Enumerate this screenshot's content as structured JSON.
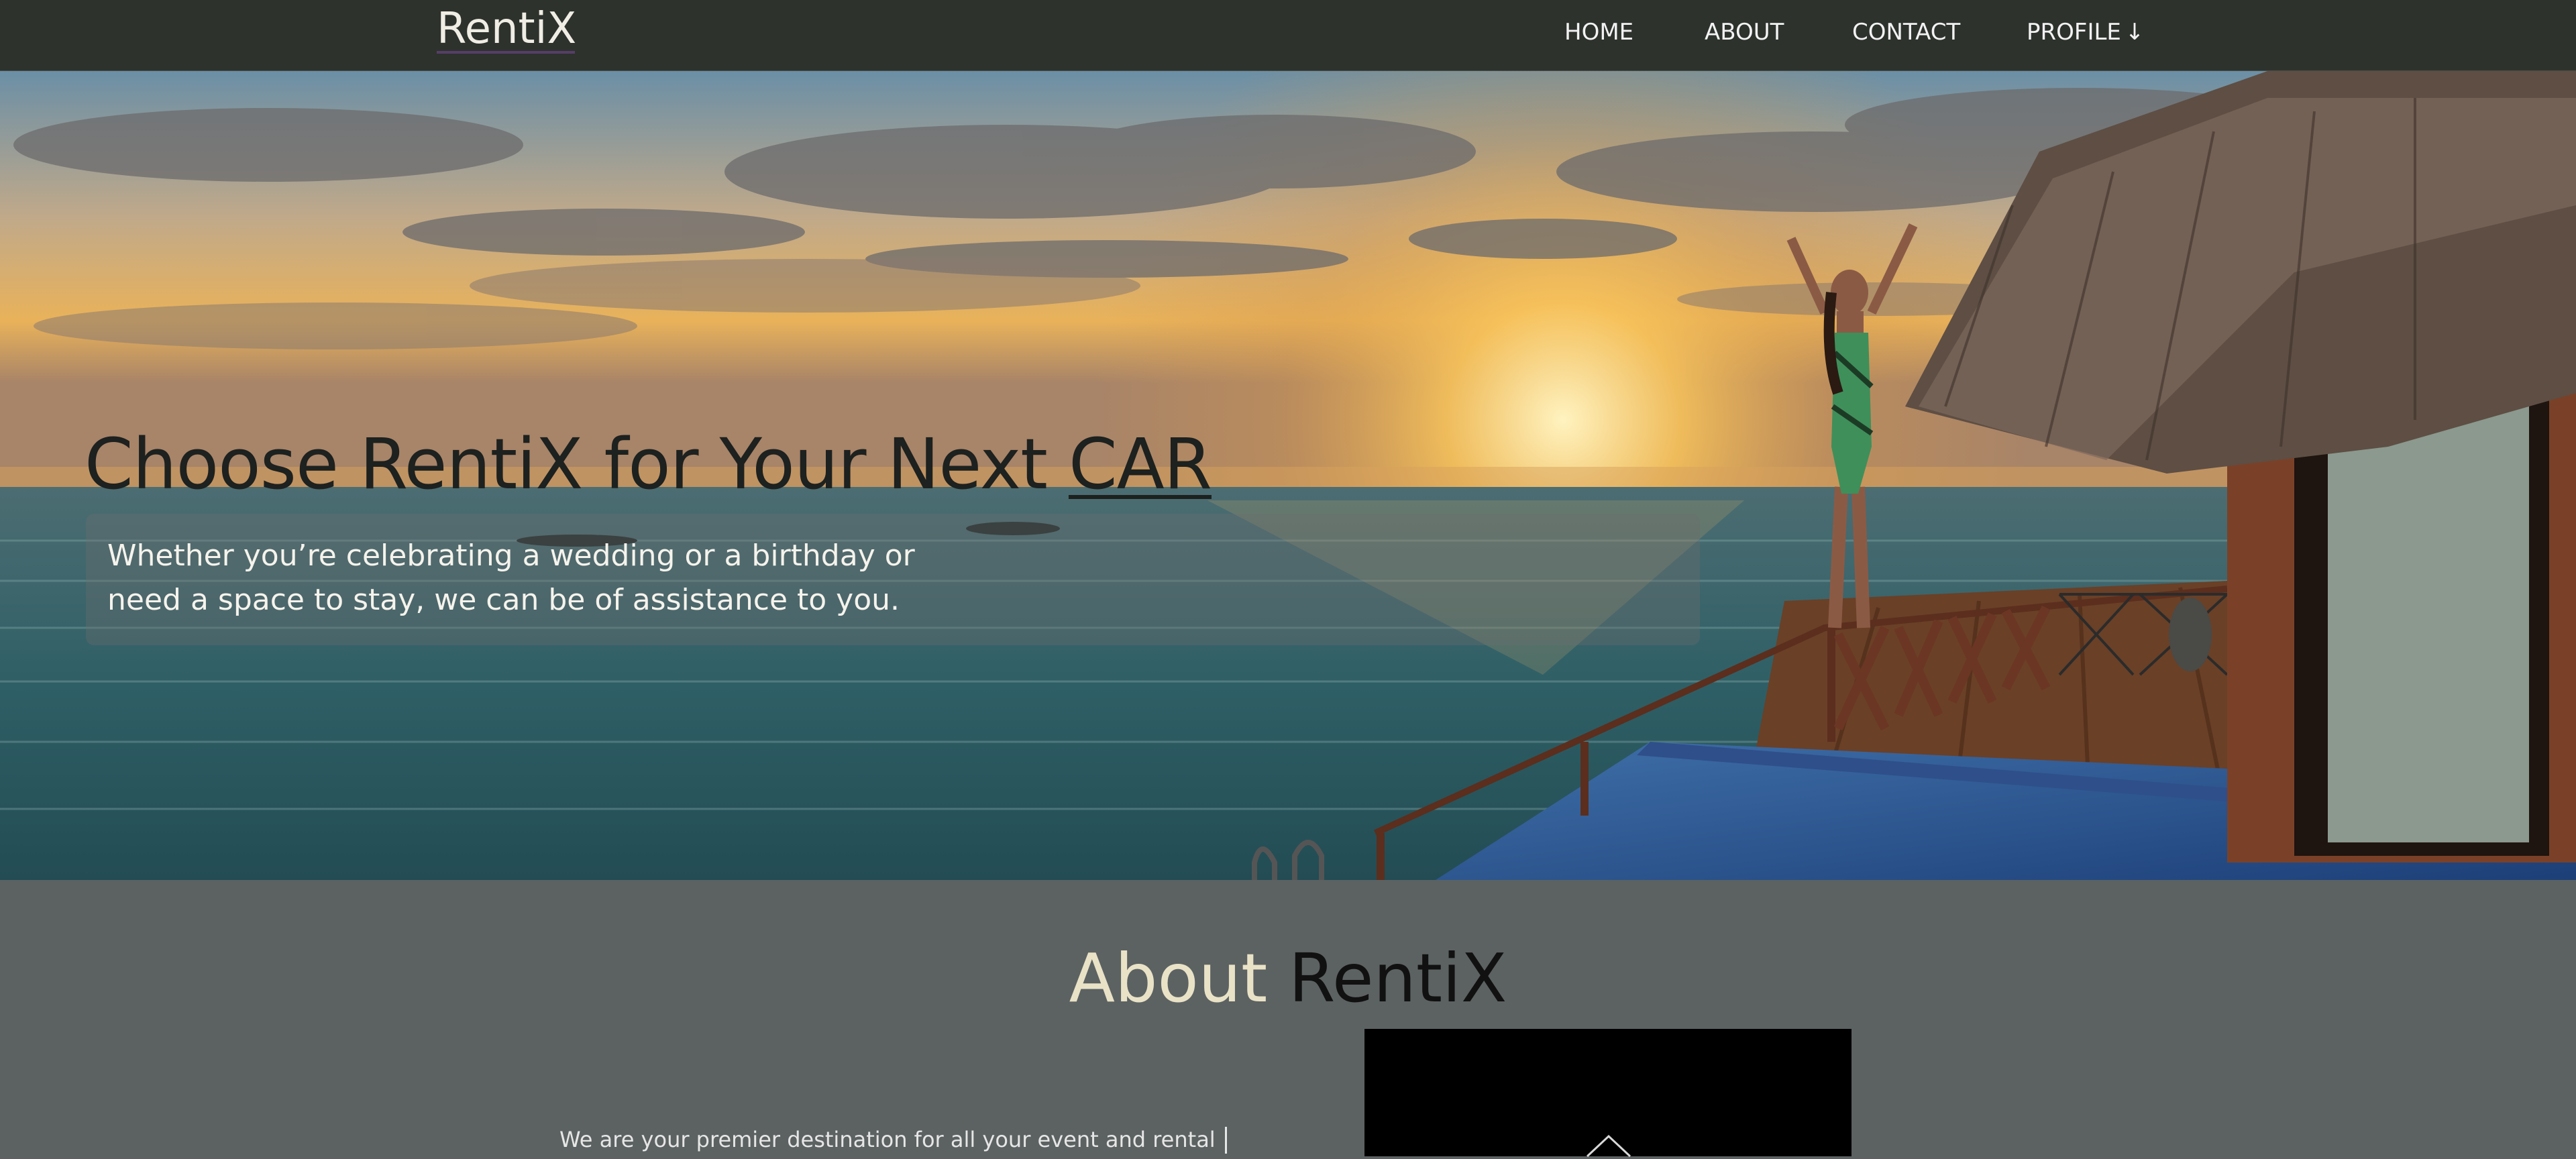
{
  "nav": {
    "logo": "RentiX",
    "items": [
      {
        "label": "HOME"
      },
      {
        "label": "ABOUT"
      },
      {
        "label": "CONTACT"
      },
      {
        "label": "PROFILE"
      }
    ],
    "profile_arrow": "↓"
  },
  "hero": {
    "title_prefix": "Choose RentiX for Your Next ",
    "title_emphasis": "CAR",
    "text": "Whether you’re celebrating a wedding or a birthday or need a space to stay, we can be of assistance to you."
  },
  "about": {
    "title_part1": "About ",
    "title_part2": "RentiX",
    "text": "We are your premier destination for all your event and rental"
  },
  "colors": {
    "nav_bg": "#2d322d",
    "section_bg": "#5c6262",
    "logo_underline": "#5b3f6e"
  }
}
